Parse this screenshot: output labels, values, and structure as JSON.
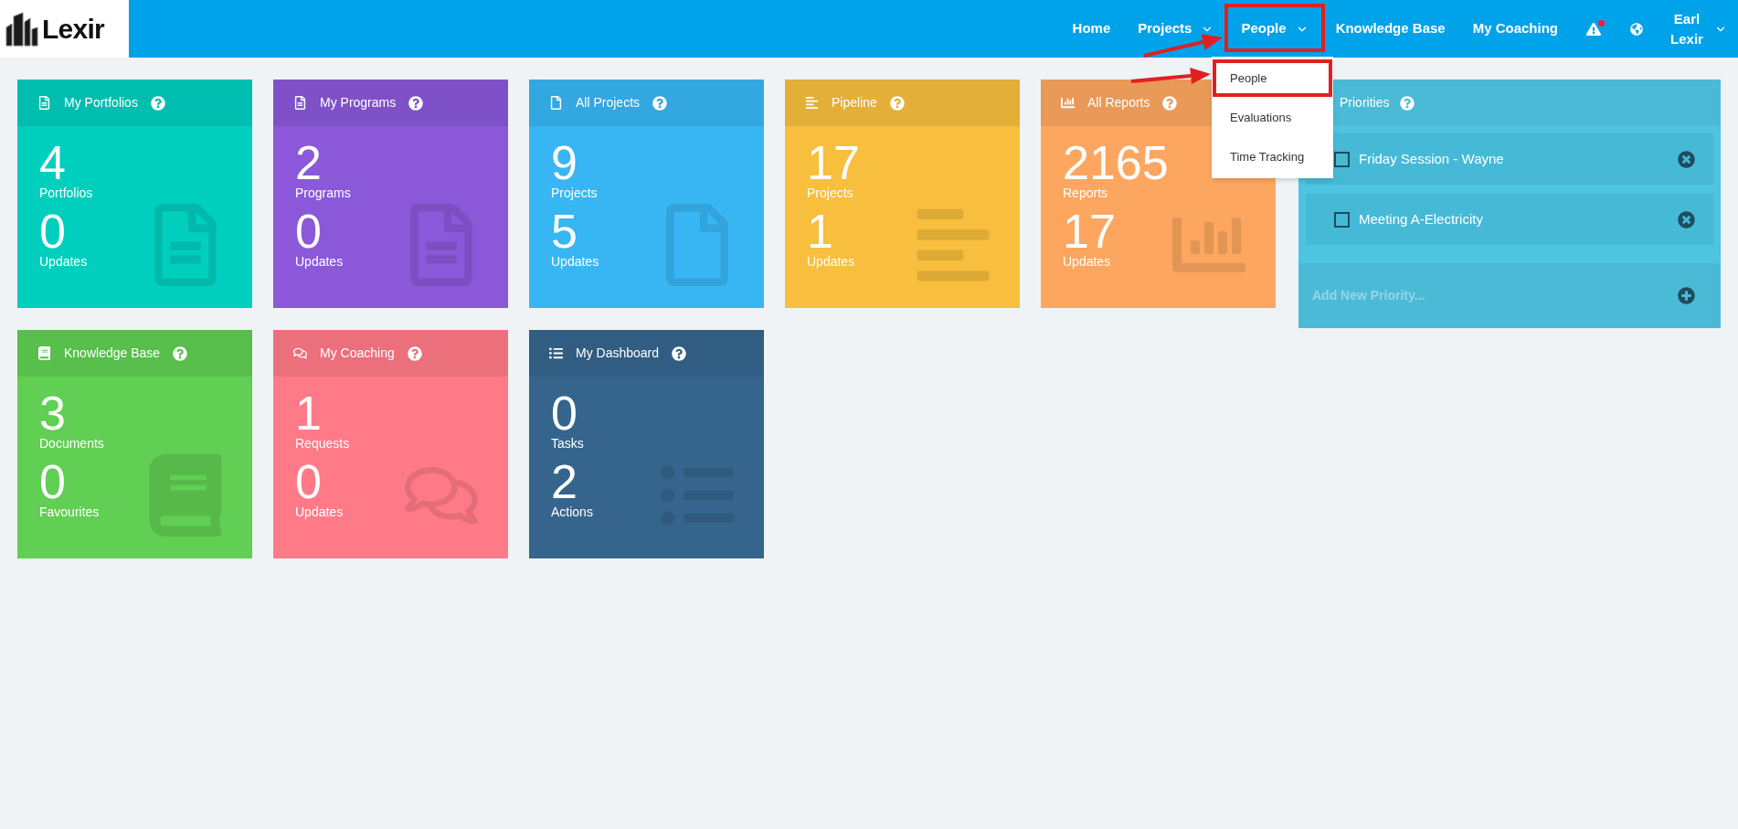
{
  "logo": {
    "text": "Lexir"
  },
  "nav": [
    {
      "label": "Home",
      "dropdown": false,
      "annotated": false
    },
    {
      "label": "Projects",
      "dropdown": true,
      "annotated": false
    },
    {
      "label": "People",
      "dropdown": true,
      "annotated": true
    },
    {
      "label": "Knowledge Base",
      "dropdown": false,
      "annotated": false
    },
    {
      "label": "My Coaching",
      "dropdown": false,
      "annotated": false
    }
  ],
  "alerts": {
    "unread": true
  },
  "user": {
    "name": "Earl Lexir"
  },
  "dropdown": {
    "items": [
      {
        "label": "People",
        "annotated": true
      },
      {
        "label": "Evaluations",
        "annotated": false
      },
      {
        "label": "Time Tracking",
        "annotated": false
      }
    ]
  },
  "tiles": [
    {
      "title": "My Portfolios",
      "kind": "document",
      "color": "#00cfbe",
      "count": "4",
      "count_label": "Portfolios",
      "updates": "0",
      "updates_label": "Updates"
    },
    {
      "title": "My Programs",
      "kind": "document",
      "color": "#8a58d9",
      "count": "2",
      "count_label": "Programs",
      "updates": "0",
      "updates_label": "Updates"
    },
    {
      "title": "All Projects",
      "kind": "project",
      "color": "#38b6f4",
      "count": "9",
      "count_label": "Projects",
      "updates": "5",
      "updates_label": "Updates"
    },
    {
      "title": "Pipeline",
      "kind": "pipeline",
      "color": "#f8be3d",
      "count": "17",
      "count_label": "Projects",
      "updates": "1",
      "updates_label": "Updates"
    },
    {
      "title": "All Reports",
      "kind": "report",
      "color": "#fda660",
      "count": "2165",
      "count_label": "Reports",
      "updates": "17",
      "updates_label": "Updates"
    },
    {
      "title": "Knowledge Base",
      "kind": "knowledge",
      "color": "#60cf53",
      "count": "3",
      "count_label": "Documents",
      "updates": "0",
      "updates_label": "Favourites"
    },
    {
      "title": "My Coaching",
      "kind": "coaching",
      "color": "#ff7a87",
      "count": "1",
      "count_label": "Requests",
      "updates": "0",
      "updates_label": "Updates"
    },
    {
      "title": "My Dashboard",
      "kind": "dashboard",
      "color": "#35658c",
      "count": "0",
      "count_label": "Tasks",
      "updates": "2",
      "updates_label": "Actions"
    }
  ],
  "priorities": {
    "title": "Priorities",
    "items": [
      {
        "label": "Friday Session - Wayne",
        "checked": false
      },
      {
        "label": "Meeting A-Electricity",
        "checked": false
      }
    ],
    "add_placeholder": "Add New Priority..."
  }
}
